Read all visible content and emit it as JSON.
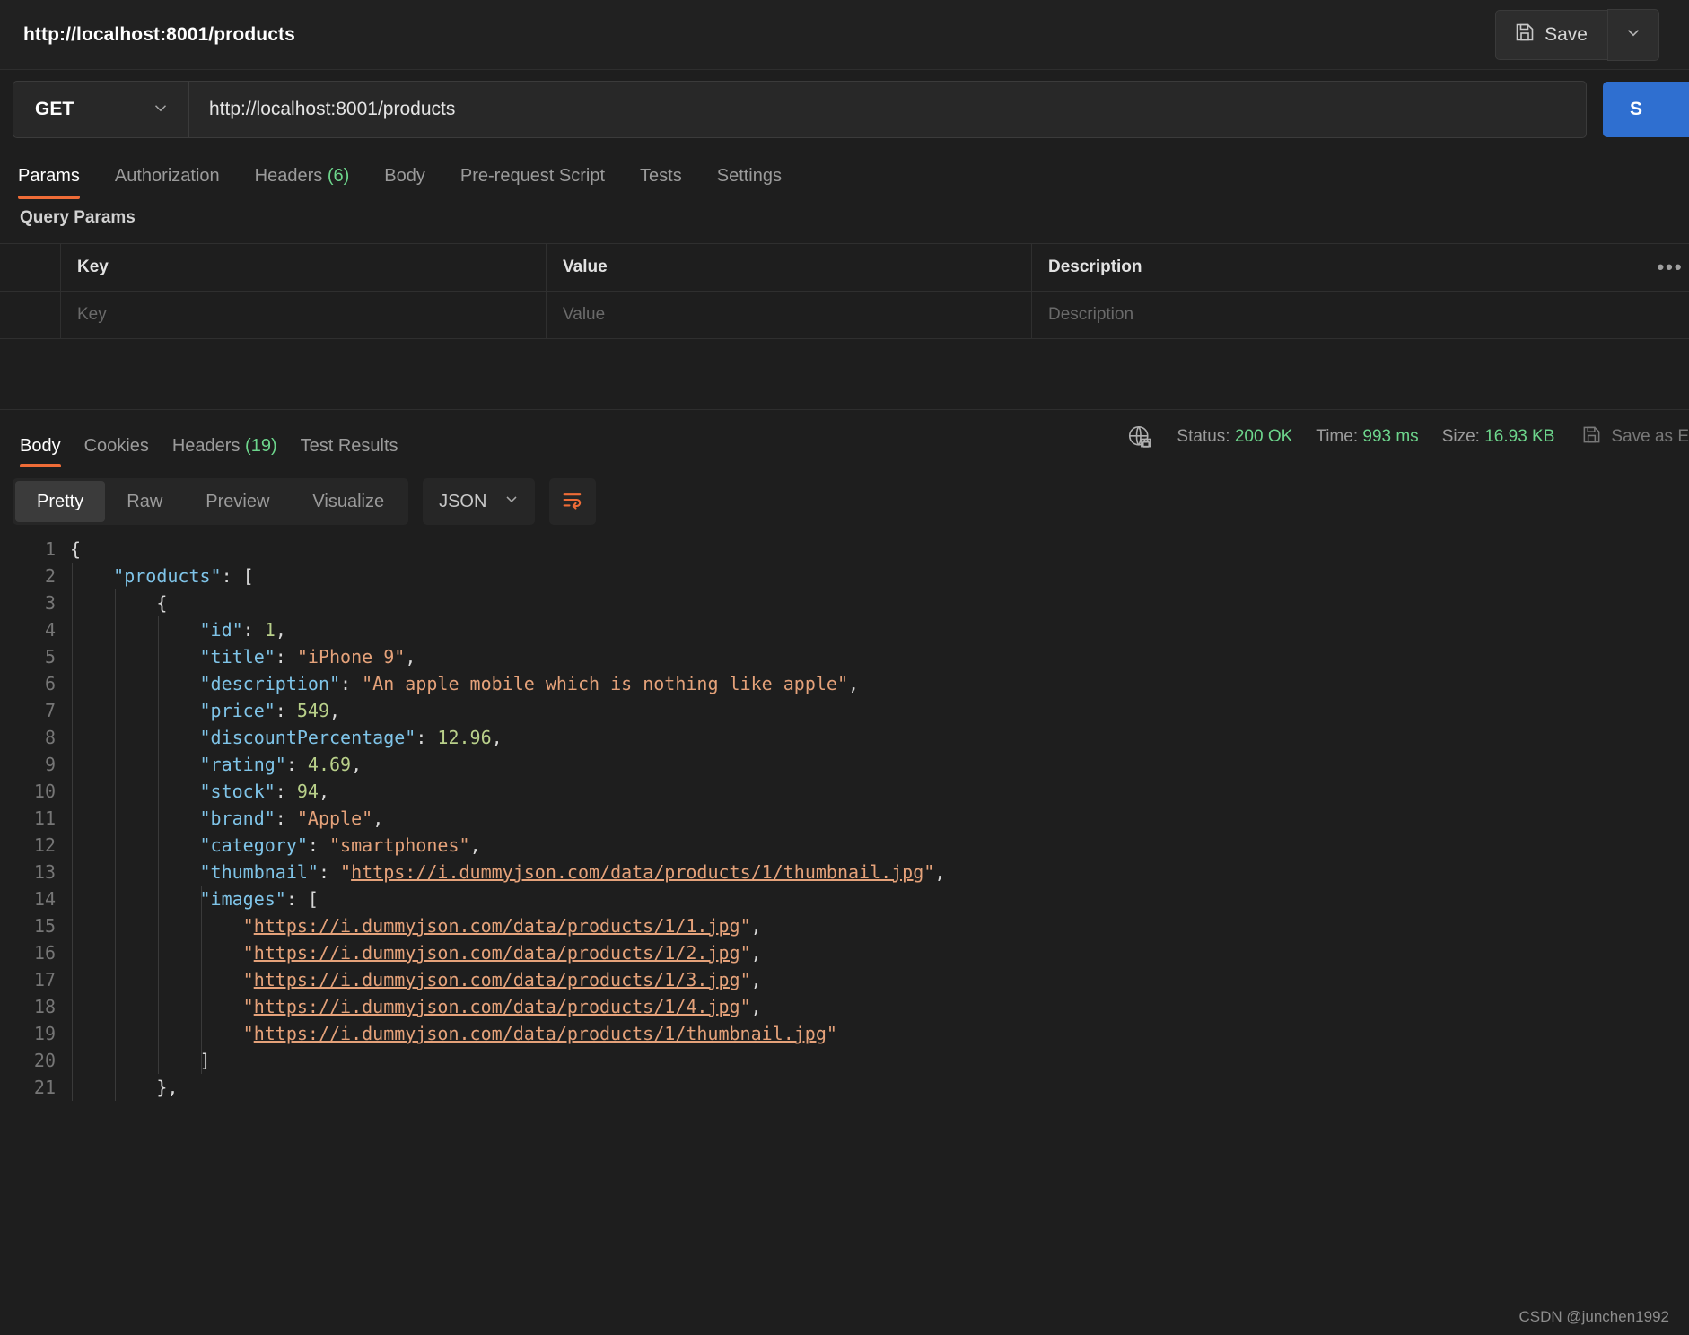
{
  "titlebar": {
    "tab_title": "http://localhost:8001/products",
    "save_label": "Save",
    "save_icon": "floppy-disk-icon",
    "caret_icon": "chevron-down-icon"
  },
  "request": {
    "method": "GET",
    "url": "http://localhost:8001/products",
    "send_label": "S"
  },
  "request_tabs": [
    {
      "label": "Params",
      "active": true,
      "count": ""
    },
    {
      "label": "Authorization",
      "active": false,
      "count": ""
    },
    {
      "label": "Headers",
      "active": false,
      "count": "(6)"
    },
    {
      "label": "Body",
      "active": false,
      "count": ""
    },
    {
      "label": "Pre-request Script",
      "active": false,
      "count": ""
    },
    {
      "label": "Tests",
      "active": false,
      "count": ""
    },
    {
      "label": "Settings",
      "active": false,
      "count": ""
    }
  ],
  "query_params": {
    "section_label": "Query Params",
    "columns": [
      "Key",
      "Value",
      "Description"
    ],
    "placeholder_row": [
      "Key",
      "Value",
      "Description"
    ],
    "bulk_icon": "ellipsis-icon"
  },
  "response_tabs": [
    {
      "label": "Body",
      "active": true,
      "count": ""
    },
    {
      "label": "Cookies",
      "active": false,
      "count": ""
    },
    {
      "label": "Headers",
      "active": false,
      "count": "(19)"
    },
    {
      "label": "Test Results",
      "active": false,
      "count": ""
    }
  ],
  "response_meta": {
    "network_icon": "globe-lock-icon",
    "status_label": "Status:",
    "status_value": "200 OK",
    "time_label": "Time:",
    "time_value": "993 ms",
    "size_label": "Size:",
    "size_value": "16.93 KB",
    "save_example_label": "Save as E",
    "save_example_icon": "floppy-disk-icon"
  },
  "view_toolbar": {
    "modes": [
      {
        "label": "Pretty",
        "active": true
      },
      {
        "label": "Raw",
        "active": false
      },
      {
        "label": "Preview",
        "active": false
      },
      {
        "label": "Visualize",
        "active": false
      }
    ],
    "format": "JSON",
    "format_caret_icon": "chevron-down-icon",
    "wrap_icon": "wrap-lines-icon"
  },
  "colors": {
    "accent": "#ef6c37",
    "success": "#6dd58c",
    "send": "#2f6fd0",
    "key": "#7fc4e8",
    "string": "#e5a27a",
    "number": "#b9d08a",
    "background": "#1e1e1e"
  },
  "code": {
    "language": "json",
    "line_numbers": [
      1,
      2,
      3,
      4,
      5,
      6,
      7,
      8,
      9,
      10,
      11,
      12,
      13,
      14,
      15,
      16,
      17,
      18,
      19,
      20,
      21
    ],
    "lines": [
      {
        "n": 1,
        "indent": 0,
        "tokens": [
          {
            "t": "p",
            "v": "{"
          }
        ]
      },
      {
        "n": 2,
        "indent": 1,
        "tokens": [
          {
            "t": "k",
            "v": "\"products\""
          },
          {
            "t": "p",
            "v": ": ["
          }
        ]
      },
      {
        "n": 3,
        "indent": 2,
        "tokens": [
          {
            "t": "p",
            "v": "{"
          }
        ]
      },
      {
        "n": 4,
        "indent": 3,
        "tokens": [
          {
            "t": "k",
            "v": "\"id\""
          },
          {
            "t": "p",
            "v": ": "
          },
          {
            "t": "n",
            "v": "1"
          },
          {
            "t": "p",
            "v": ","
          }
        ]
      },
      {
        "n": 5,
        "indent": 3,
        "tokens": [
          {
            "t": "k",
            "v": "\"title\""
          },
          {
            "t": "p",
            "v": ": "
          },
          {
            "t": "s",
            "v": "\"iPhone 9\""
          },
          {
            "t": "p",
            "v": ","
          }
        ]
      },
      {
        "n": 6,
        "indent": 3,
        "tokens": [
          {
            "t": "k",
            "v": "\"description\""
          },
          {
            "t": "p",
            "v": ": "
          },
          {
            "t": "s",
            "v": "\"An apple mobile which is nothing like apple\""
          },
          {
            "t": "p",
            "v": ","
          }
        ]
      },
      {
        "n": 7,
        "indent": 3,
        "tokens": [
          {
            "t": "k",
            "v": "\"price\""
          },
          {
            "t": "p",
            "v": ": "
          },
          {
            "t": "n",
            "v": "549"
          },
          {
            "t": "p",
            "v": ","
          }
        ]
      },
      {
        "n": 8,
        "indent": 3,
        "tokens": [
          {
            "t": "k",
            "v": "\"discountPercentage\""
          },
          {
            "t": "p",
            "v": ": "
          },
          {
            "t": "n",
            "v": "12.96"
          },
          {
            "t": "p",
            "v": ","
          }
        ]
      },
      {
        "n": 9,
        "indent": 3,
        "tokens": [
          {
            "t": "k",
            "v": "\"rating\""
          },
          {
            "t": "p",
            "v": ": "
          },
          {
            "t": "n",
            "v": "4.69"
          },
          {
            "t": "p",
            "v": ","
          }
        ]
      },
      {
        "n": 10,
        "indent": 3,
        "tokens": [
          {
            "t": "k",
            "v": "\"stock\""
          },
          {
            "t": "p",
            "v": ": "
          },
          {
            "t": "n",
            "v": "94"
          },
          {
            "t": "p",
            "v": ","
          }
        ]
      },
      {
        "n": 11,
        "indent": 3,
        "tokens": [
          {
            "t": "k",
            "v": "\"brand\""
          },
          {
            "t": "p",
            "v": ": "
          },
          {
            "t": "s",
            "v": "\"Apple\""
          },
          {
            "t": "p",
            "v": ","
          }
        ]
      },
      {
        "n": 12,
        "indent": 3,
        "tokens": [
          {
            "t": "k",
            "v": "\"category\""
          },
          {
            "t": "p",
            "v": ": "
          },
          {
            "t": "s",
            "v": "\"smartphones\""
          },
          {
            "t": "p",
            "v": ","
          }
        ]
      },
      {
        "n": 13,
        "indent": 3,
        "tokens": [
          {
            "t": "k",
            "v": "\"thumbnail\""
          },
          {
            "t": "p",
            "v": ": "
          },
          {
            "t": "s",
            "v": "\""
          },
          {
            "t": "lnk",
            "v": "https://i.dummyjson.com/data/products/1/thumbnail.jpg"
          },
          {
            "t": "s",
            "v": "\""
          },
          {
            "t": "p",
            "v": ","
          }
        ]
      },
      {
        "n": 14,
        "indent": 3,
        "tokens": [
          {
            "t": "k",
            "v": "\"images\""
          },
          {
            "t": "p",
            "v": ": ["
          }
        ]
      },
      {
        "n": 15,
        "indent": 4,
        "tokens": [
          {
            "t": "s",
            "v": "\""
          },
          {
            "t": "lnk",
            "v": "https://i.dummyjson.com/data/products/1/1.jpg"
          },
          {
            "t": "s",
            "v": "\""
          },
          {
            "t": "p",
            "v": ","
          }
        ]
      },
      {
        "n": 16,
        "indent": 4,
        "tokens": [
          {
            "t": "s",
            "v": "\""
          },
          {
            "t": "lnk",
            "v": "https://i.dummyjson.com/data/products/1/2.jpg"
          },
          {
            "t": "s",
            "v": "\""
          },
          {
            "t": "p",
            "v": ","
          }
        ]
      },
      {
        "n": 17,
        "indent": 4,
        "tokens": [
          {
            "t": "s",
            "v": "\""
          },
          {
            "t": "lnk",
            "v": "https://i.dummyjson.com/data/products/1/3.jpg"
          },
          {
            "t": "s",
            "v": "\""
          },
          {
            "t": "p",
            "v": ","
          }
        ]
      },
      {
        "n": 18,
        "indent": 4,
        "tokens": [
          {
            "t": "s",
            "v": "\""
          },
          {
            "t": "lnk",
            "v": "https://i.dummyjson.com/data/products/1/4.jpg"
          },
          {
            "t": "s",
            "v": "\""
          },
          {
            "t": "p",
            "v": ","
          }
        ]
      },
      {
        "n": 19,
        "indent": 4,
        "tokens": [
          {
            "t": "s",
            "v": "\""
          },
          {
            "t": "lnk",
            "v": "https://i.dummyjson.com/data/products/1/thumbnail.jpg"
          },
          {
            "t": "s",
            "v": "\""
          }
        ]
      },
      {
        "n": 20,
        "indent": 3,
        "tokens": [
          {
            "t": "p",
            "v": "]"
          }
        ]
      },
      {
        "n": 21,
        "indent": 2,
        "tokens": [
          {
            "t": "p",
            "v": "},"
          }
        ]
      }
    ]
  },
  "watermark": "CSDN @junchen1992"
}
